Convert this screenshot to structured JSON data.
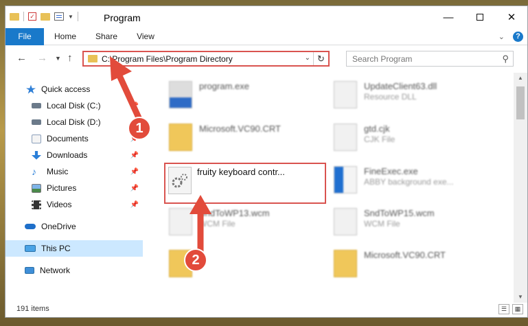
{
  "window": {
    "title": "Program",
    "controls": {
      "minimize": "—",
      "maximize": "",
      "close": "✕"
    }
  },
  "ribbon": {
    "tabs": [
      "File",
      "Home",
      "Share",
      "View"
    ],
    "expand_icon": "chevron-down-icon"
  },
  "address_bar": {
    "path": "C:\\Program Files\\Program Directory"
  },
  "search": {
    "placeholder": "Search Program"
  },
  "sidebar": {
    "items": [
      {
        "label": "Quick access",
        "icon": "star-icon",
        "pinned": false
      },
      {
        "label": "Local Disk (C:)",
        "icon": "drive-icon",
        "pinned": true
      },
      {
        "label": "Local Disk (D:)",
        "icon": "drive-icon",
        "pinned": true
      },
      {
        "label": "Documents",
        "icon": "documents-icon",
        "pinned": true
      },
      {
        "label": "Downloads",
        "icon": "download-icon",
        "pinned": true
      },
      {
        "label": "Music",
        "icon": "music-icon",
        "pinned": true
      },
      {
        "label": "Pictures",
        "icon": "pictures-icon",
        "pinned": true
      },
      {
        "label": "Videos",
        "icon": "videos-icon",
        "pinned": true
      },
      {
        "label": "OneDrive",
        "icon": "cloud-icon",
        "pinned": false
      },
      {
        "label": "This PC",
        "icon": "computer-icon",
        "pinned": false,
        "selected": true
      },
      {
        "label": "Network",
        "icon": "network-icon",
        "pinned": false
      }
    ]
  },
  "files": [
    {
      "name": "program.exe",
      "type": ""
    },
    {
      "name": "UpdateClient63.dll",
      "type": "Resource DLL"
    },
    {
      "name": "Microsoft.VC90.CRT",
      "type": ""
    },
    {
      "name": "gtd.cjk",
      "type": "CJK File"
    },
    {
      "name": "fruity keyboard contr...",
      "type": ""
    },
    {
      "name": "FineExec.exe",
      "type": "ABBY background exe..."
    },
    {
      "name": "SndToWP13.wcm",
      "type": "WCM File"
    },
    {
      "name": "SndToWP15.wcm",
      "type": "WCM File"
    },
    {
      "name": "",
      "type": ""
    },
    {
      "name": "Microsoft.VC90.CRT",
      "type": ""
    }
  ],
  "status": {
    "item_count": "191 items"
  },
  "annotations": {
    "step1": "1",
    "step2": "2"
  },
  "colors": {
    "accent": "#1979ca",
    "highlight": "#d9534f",
    "selected": "#cce8ff"
  }
}
